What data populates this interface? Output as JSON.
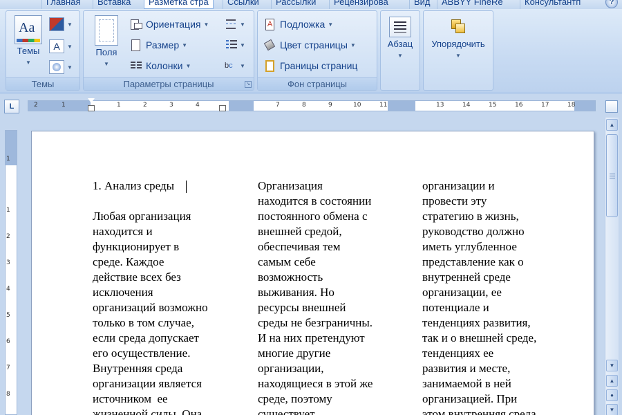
{
  "tabs": [
    "Главная",
    "Вставка",
    "Разметка стра",
    "Ссылки",
    "Рассылки",
    "Рецензирова",
    "Вид",
    "ABBYY FineRe",
    "Консультантп"
  ],
  "active_tab": "Разметка стра",
  "ribbon": {
    "themes": {
      "label": "Темы",
      "button": "Темы",
      "icon_text": "Aa",
      "small_icon_a": "A"
    },
    "page_setup": {
      "label": "Параметры страницы",
      "fields_button": "Поля",
      "orientation": "Ориентация",
      "size": "Размер",
      "columns": "Колонки"
    },
    "page_background": {
      "label": "Фон страницы",
      "watermark": "Подложка",
      "page_color": "Цвет страницы",
      "page_borders": "Границы страниц"
    },
    "paragraph": {
      "button": "Абзац"
    },
    "arrange": {
      "button": "Упорядочить"
    }
  },
  "ruler": {
    "ticks": [
      "2",
      "1",
      "1",
      "2",
      "3",
      "4",
      "7",
      "8",
      "9",
      "10",
      "11",
      "13",
      "14",
      "15",
      "16",
      "17",
      "18"
    ]
  },
  "vruler": {
    "ticks": [
      "1",
      "1",
      "2",
      "3",
      "4",
      "5",
      "6",
      "7",
      "8"
    ]
  },
  "document": {
    "col1": "1. Анализ среды\n\nЛюбая организация\nнаходится и\nфункционирует в\nсреде. Каждое\nдействие всех без\nисключения\nорганизаций возможно\nтолько в том случае,\nесли среда допускает\nего осуществление.\nВнутренняя среда\nорганизации является\nисточником  ее\nжизненной силы. Она",
    "col2": "Организация\nнаходится в состоянии\nпостоянного обмена с\nвнешней средой,\nобеспечивая тем\nсамым себе\nвозможность\nвыживания. Но\nресурсы внешней\nсреды не безграничны.\nИ на них претендуют\nмногие другие\nорганизации,\nнаходящиеся в этой же\nсреде, поэтому\nсуществует",
    "col3": "организации и\nпровести эту\nстратегию в жизнь,\nруководство должно\nиметь углубленное\nпредставление как о\nвнутренней среде\nорганизации, ее\nпотенциале и\nтенденциях развития,\nтак и о внешней среде,\nтенденциях ее\nразвития и месте,\nзанимаемой в ней\nорганизацией. При\nэтом внутренняя среда"
  }
}
